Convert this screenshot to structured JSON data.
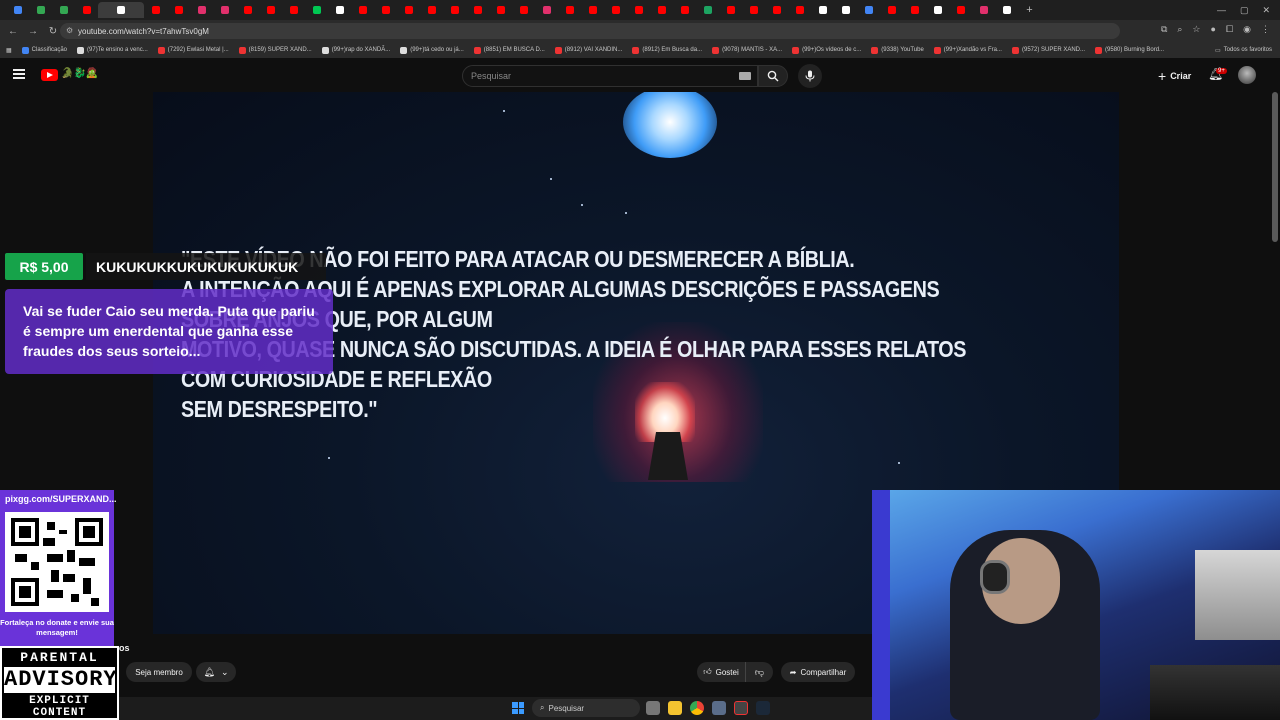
{
  "browser": {
    "tab_colors": [
      "#4285f4",
      "#34a853",
      "#34a853",
      "#ff0000",
      "#ffffff",
      "#ff0000",
      "#ff0000",
      "#e1306c",
      "#e1306c",
      "#ff0000",
      "#ff0000",
      "#ff0000",
      "#00c853",
      "#ffffff",
      "#ff0000",
      "#ff0000",
      "#ff0000",
      "#ff0000",
      "#ff0000",
      "#ff0000",
      "#ff0000",
      "#ff0000",
      "#e1306c",
      "#ff0000",
      "#ff0000",
      "#ff0000",
      "#ff0000",
      "#ff0000",
      "#ff0000",
      "#1da462",
      "#ff0000",
      "#ff0000",
      "#ff0000",
      "#ff0000",
      "#ffffff",
      "#ffffff",
      "#4285f4",
      "#ff0000",
      "#ff0000",
      "#ffffff",
      "#ff0000",
      "#e1306c",
      "#ffffff"
    ],
    "url": "youtube.com/watch?v=t7ahwTsv0gM",
    "bookmarks": [
      "Classificação",
      "(97)Te ensino a venc...",
      "(7292) Ewlasi Metal |...",
      "(8159) SUPER XAND...",
      "(99+)rap do XANDÃ...",
      "(99+)tá cedo ou já...",
      "(8851) EM BUSCA D...",
      "(8912) VAI XANDIN...",
      "(8912) Em Busca da...",
      "(9078) MANTIS - XA...",
      "(99+)Os vídeos de c...",
      "(9338) YouTube",
      "(99+)Xandão vs Fra...",
      "(9572) SUPER XAND...",
      "(9580) Burning Bord..."
    ],
    "all_favorites": "Todos os favoritos"
  },
  "youtube": {
    "search_placeholder": "Pesquisar",
    "create_label": "Criar",
    "notification_count": "9+",
    "logo_decoration": "🐊🐉🧟"
  },
  "video": {
    "disclaimer_lines": [
      "\"ESTE VÍDEO NÃO FOI FEITO PARA ATACAR OU DESMERECER A BÍBLIA.",
      "A INTENÇÃO AQUI É APENAS EXPLORAR ALGUMAS DESCRIÇÕES E PASSAGENS SOBRE ANJOS QUE, POR ALGUM",
      "MOTIVO, QUASE NUNCA SÃO DISCUTIDAS. A IDEIA É OLHAR PARA ESSES RELATOS COM CURIOSIDADE E REFLEXÃO",
      "SEM DESRESPEITO.\""
    ]
  },
  "donation": {
    "amount": "R$ 5,00",
    "name": "KUKUKUKKUKUKUKUKUKUK",
    "message": "Vai se fuder Caio seu merda. Puta que pariu é sempre um enerdental que ganha esse fraudes dos seus sorteio..."
  },
  "pix": {
    "url": "pixgg.com/SUPERXAND...",
    "cta": "Fortaleça no donate e envie sua mensagem!"
  },
  "advisory": {
    "top": "PARENTAL",
    "middle": "ADVISORY",
    "bottom": "EXPLICIT CONTENT"
  },
  "actions": {
    "channel_suffix": "os",
    "join_label": "Seja membro",
    "like_label": "Gostei",
    "share_label": "Compartilhar"
  },
  "taskbar": {
    "search_label": "Pesquisar"
  }
}
